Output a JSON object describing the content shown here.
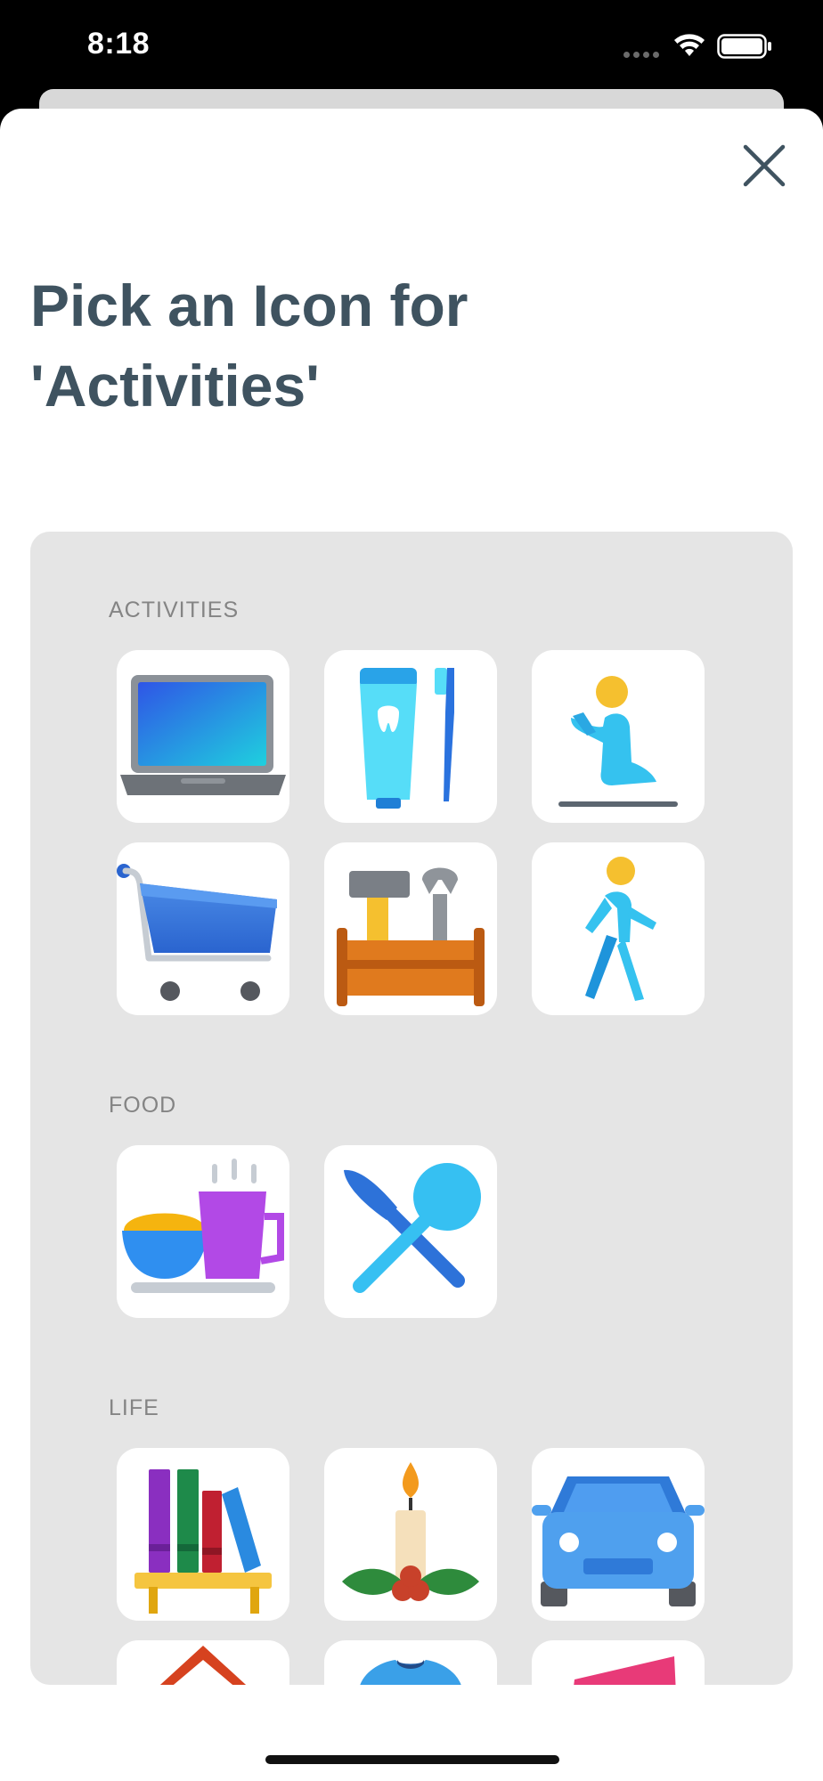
{
  "status_bar": {
    "time": "8:18"
  },
  "sheet": {
    "title_line1": "Pick an Icon for",
    "title_line2": "'Activities'"
  },
  "sections": [
    {
      "label": "ACTIVITIES",
      "icons": [
        "laptop-icon",
        "toothpaste-toothbrush-icon",
        "prayer-icon",
        "shopping-cart-icon",
        "toolbox-icon",
        "walking-icon"
      ]
    },
    {
      "label": "FOOD",
      "icons": [
        "breakfast-icon",
        "cutlery-icon"
      ]
    },
    {
      "label": "LIFE",
      "icons": [
        "bookshelf-icon",
        "candle-icon",
        "car-icon",
        "house-icon",
        "tshirt-icon",
        "pink-icon"
      ]
    }
  ]
}
